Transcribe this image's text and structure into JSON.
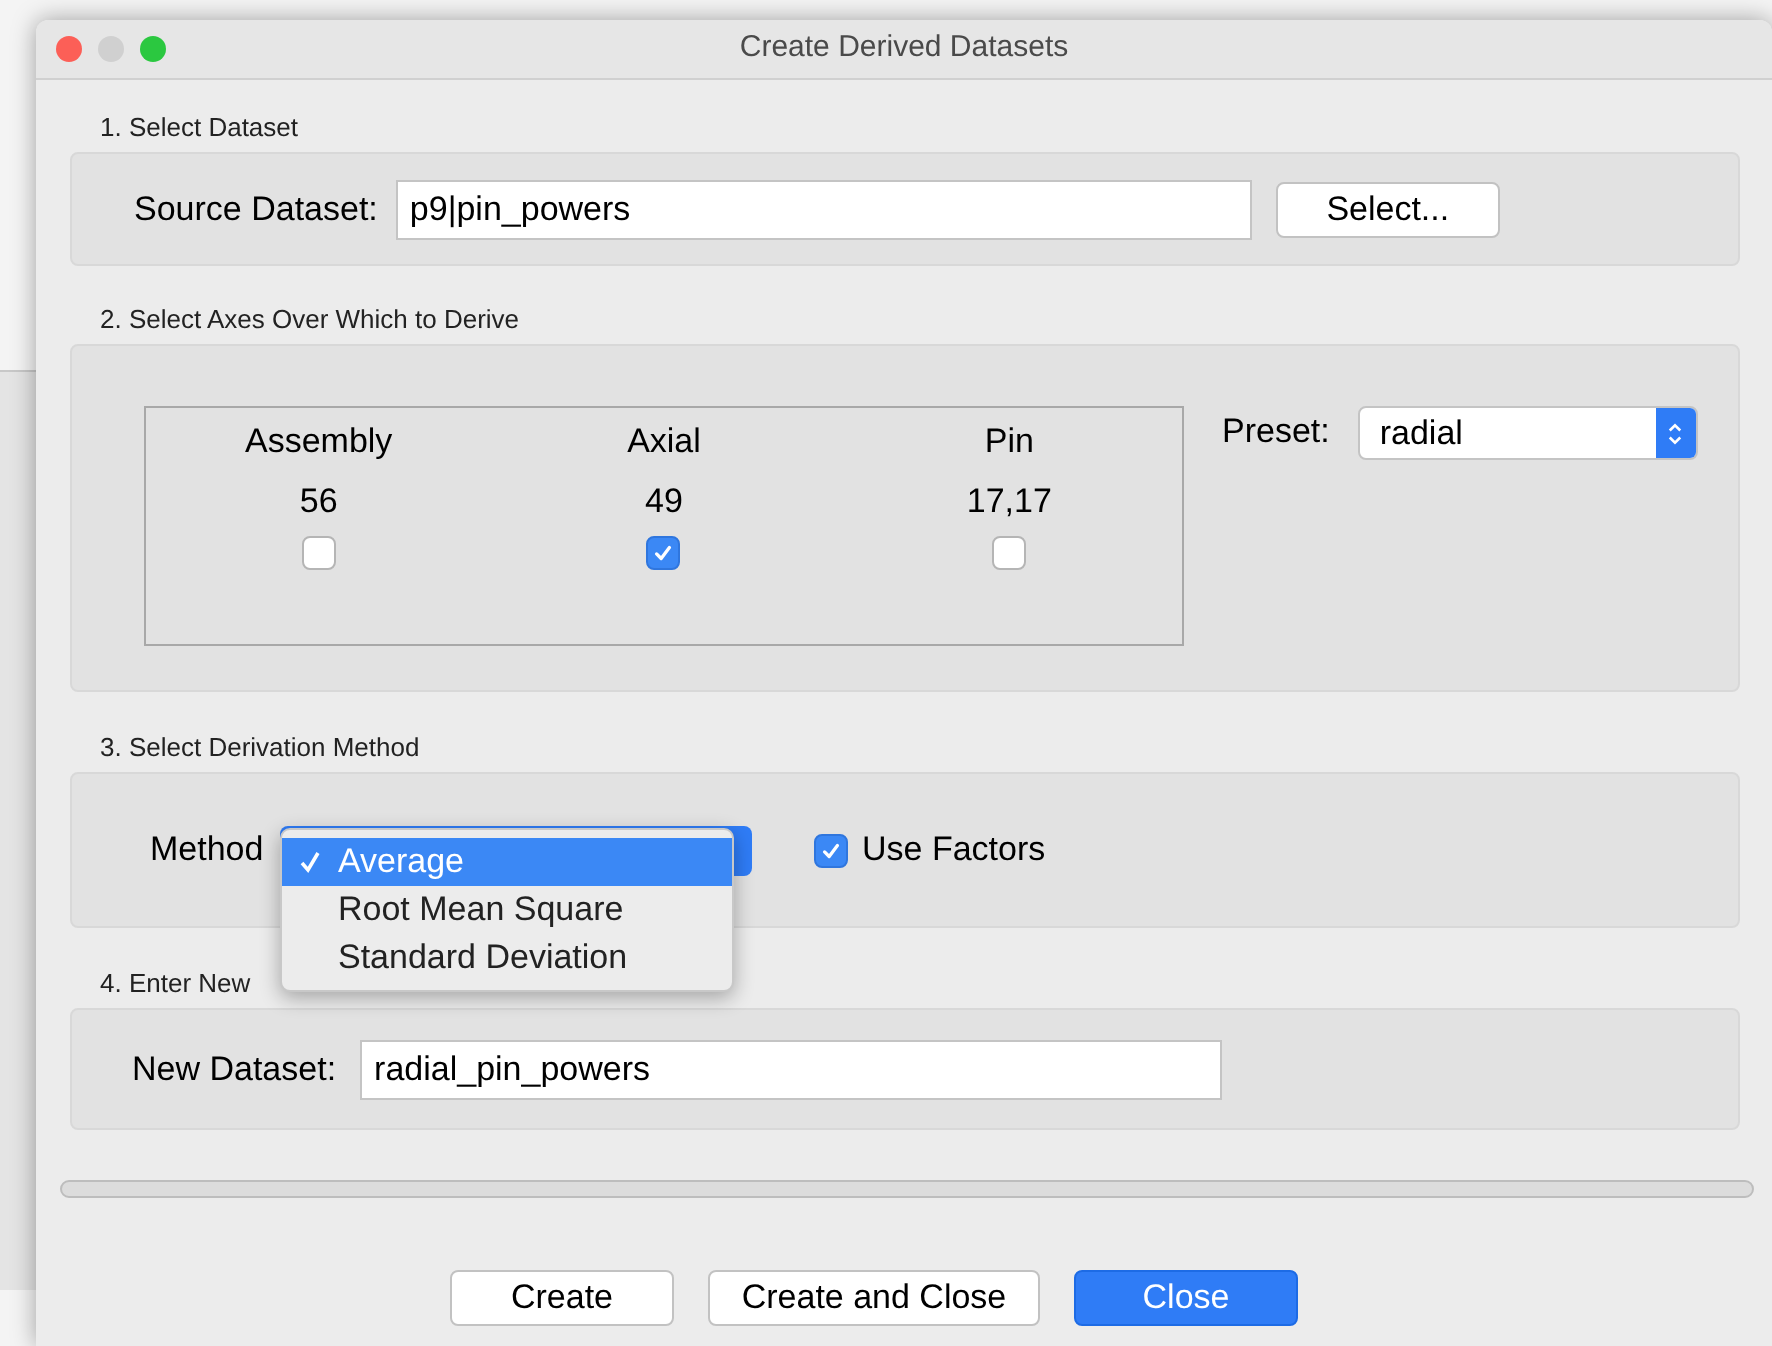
{
  "window": {
    "title": "Create Derived Datasets"
  },
  "select_dataset": {
    "heading": "1. Select Dataset",
    "label": "Source Dataset:",
    "value": "p9|pin_powers",
    "button": "Select..."
  },
  "axes": {
    "heading": "2. Select Axes Over Which to Derive",
    "items": [
      {
        "name": "Assembly",
        "size": "56",
        "checked": false
      },
      {
        "name": "Axial",
        "size": "49",
        "checked": true
      },
      {
        "name": "Pin",
        "size": "17,17",
        "checked": false
      }
    ],
    "preset_label": "Preset:",
    "preset": "radial"
  },
  "method": {
    "heading": "3. Select Derivation Method",
    "label": "Method",
    "menu": [
      {
        "label": "Average",
        "selected": true
      },
      {
        "label": "Root Mean Square",
        "selected": false
      },
      {
        "label": "Standard Deviation",
        "selected": false
      }
    ],
    "use_factors": {
      "label": "Use Factors",
      "checked": true
    }
  },
  "new_dataset": {
    "heading": "4. Enter New",
    "label": "New Dataset:",
    "value": "radial_pin_powers"
  },
  "progress": {
    "level": 0
  },
  "buttons": [
    {
      "label": "Create",
      "default": false
    },
    {
      "label": "Create and Close",
      "default": false
    },
    {
      "label": "Close",
      "default": true
    }
  ]
}
